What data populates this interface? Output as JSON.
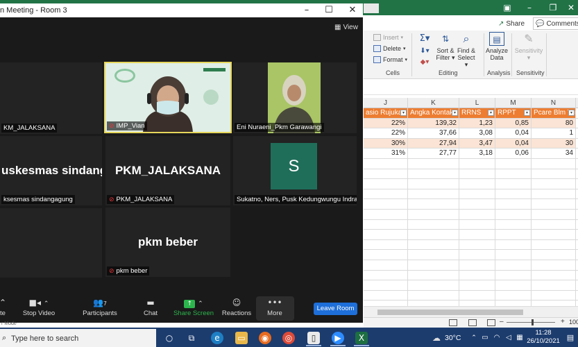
{
  "excel": {
    "share_label": "Share",
    "comments_label": "Comments",
    "ribbon": {
      "insert": "Insert",
      "delete": "Delete",
      "format": "Format",
      "cells_group": "Cells",
      "sort_filter_1": "Sort &",
      "sort_filter_2": "Filter",
      "find_select_1": "Find &",
      "find_select_2": "Select",
      "editing_group": "Editing",
      "analyze_1": "Analyze",
      "analyze_2": "Data",
      "analysis_group": "Analysis",
      "sensitivity": "Sensitivity",
      "sensitivity_group": "Sensitivity"
    },
    "columns": [
      "J",
      "K",
      "L",
      "M",
      "N"
    ],
    "header_row": [
      "asio Rujukan",
      "Angka Kontak",
      "RRNS",
      "RPPT",
      "Pcare Blm Tun"
    ],
    "rows": [
      [
        "22%",
        "139,32",
        "1,23",
        "0,85",
        "80"
      ],
      [
        "22%",
        "37,66",
        "3,08",
        "0,04",
        "1"
      ],
      [
        "30%",
        "27,94",
        "3,47",
        "0,04",
        "30"
      ],
      [
        "31%",
        "27,77",
        "3,18",
        "0,06",
        "34"
      ]
    ],
    "zoom_level": "100"
  },
  "zoom": {
    "title": "n Meeting - Room 3",
    "view_label": "View",
    "participants": [
      {
        "name": "KM_JALAKSANA",
        "big": ""
      },
      {
        "name": "IMP_Vian",
        "big": ""
      },
      {
        "name": "Eni Nuraeni_Pkm Garawangi",
        "big": ""
      },
      {
        "name": "ksesmas sindangagung",
        "big": "uskesmas  sindang..."
      },
      {
        "name": "PKM_JALAKSANA",
        "big": "PKM_JALAKSANA"
      },
      {
        "name": "Sukatno, Ners, Pusk Kedungwungu Indram...",
        "big": "S"
      },
      {
        "name": "pkm beber",
        "big": "pkm beber"
      }
    ],
    "toolbar": {
      "mute": "te",
      "stop_video": "Stop Video",
      "participants": "Participants",
      "participants_count": "7",
      "chat": "Chat",
      "share_screen": "Share Screen",
      "reactions": "Reactions",
      "more": "More",
      "leave": "Leave Room"
    },
    "bottom_tag": "r Mode"
  },
  "taskbar": {
    "search_placeholder": "Type here to search",
    "temperature": "30°C",
    "time": "11:28",
    "date": "26/10/2021"
  }
}
